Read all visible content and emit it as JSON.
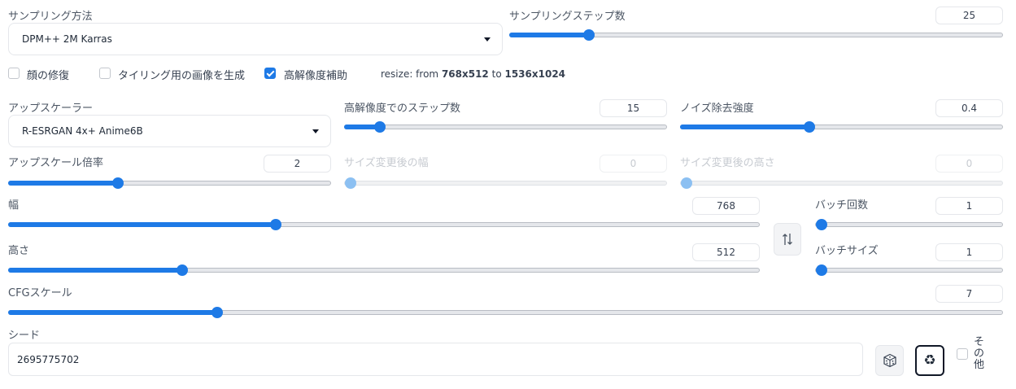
{
  "sampling": {
    "method_label": "サンプリング方法",
    "method_value": "DPM++ 2M Karras",
    "steps_label": "サンプリングステップ数",
    "steps_value": "25",
    "steps_fraction": 0.16
  },
  "options": {
    "face_restore_label": "顔の修復",
    "face_restore_checked": false,
    "tiling_label": "タイリング用の画像を生成",
    "tiling_checked": false,
    "hires_label": "高解像度補助",
    "hires_checked": true,
    "resize_prefix": "resize: from",
    "resize_from": "768x512",
    "resize_to_word": "to",
    "resize_to": "1536x1024"
  },
  "hires": {
    "upscaler_label": "アップスケーラー",
    "upscaler_value": "R-ESRGAN 4x+ Anime6B",
    "hires_steps_label": "高解像度でのステップ数",
    "hires_steps_value": "15",
    "hires_steps_fraction": 0.11,
    "denoise_label": "ノイズ除去強度",
    "denoise_value": "0.4",
    "denoise_fraction": 0.4,
    "upscale_by_label": "アップスケール倍率",
    "upscale_by_value": "2",
    "upscale_by_fraction": 0.34,
    "resize_w_label": "サイズ変更後の幅",
    "resize_w_value": "0",
    "resize_h_label": "サイズ変更後の高さ",
    "resize_h_value": "0"
  },
  "size": {
    "width_label": "幅",
    "width_value": "768",
    "width_fraction": 0.356,
    "height_label": "高さ",
    "height_value": "512",
    "height_fraction": 0.231,
    "swap_icon": "swap-vertical-icon"
  },
  "batch": {
    "count_label": "バッチ回数",
    "count_value": "1",
    "size_label": "バッチサイズ",
    "size_value": "1"
  },
  "cfg": {
    "label": "CFGスケール",
    "value": "7",
    "fraction": 0.21
  },
  "seed": {
    "label": "シード",
    "value": "2695775702",
    "random_icon": "dice-icon",
    "reuse_icon": "recycle-icon",
    "extra_label": "その他",
    "extra_checked": false
  },
  "colors": {
    "accent": "#1e7ae6"
  }
}
